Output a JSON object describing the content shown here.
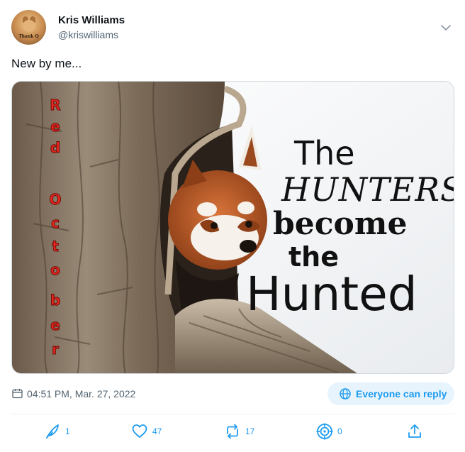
{
  "author": {
    "display_name": "Kris Williams",
    "handle": "@kriswilliams",
    "avatar_caption": "Thank Q"
  },
  "tweet": {
    "text": "New by me..."
  },
  "media": {
    "image_text": {
      "vertical_title": [
        "Red",
        "October"
      ],
      "line1": "The",
      "line2": "HUNTERS",
      "line3": "become",
      "line4": "the",
      "line5": "Hunted"
    }
  },
  "meta": {
    "timestamp": "04:51 PM, Mar. 27, 2022",
    "reply_setting": "Everyone can reply"
  },
  "actions": {
    "quill_count": "1",
    "likes": "47",
    "retweets": "17",
    "target_count": "0"
  },
  "colors": {
    "accent": "#1d9bf0",
    "text": "#0f1419",
    "muted": "#536471",
    "pill_bg": "#e8f4fd"
  },
  "icons": {
    "more": "chevron-down-icon",
    "timestamp": "calendar-icon",
    "reply": "globe-icon",
    "quill": "quill-icon",
    "like": "heart-icon",
    "retweet": "retweet-icon",
    "target": "target-icon",
    "share": "share-icon"
  }
}
